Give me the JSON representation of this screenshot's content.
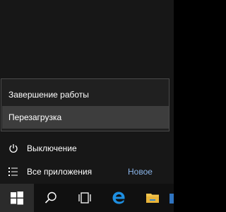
{
  "power_menu": {
    "shutdown_label": "Завершение работы",
    "restart_label": "Перезагрузка",
    "hovered_item": "restart"
  },
  "start_menu": {
    "power_label": "Выключение",
    "all_apps_label": "Все приложения",
    "new_badge": "Новое"
  },
  "taskbar": {
    "buttons": [
      "windows-logo-icon",
      "search-icon",
      "task-view-icon",
      "edge-icon",
      "file-explorer-icon",
      "store-icon"
    ]
  },
  "colors": {
    "menu_background": "#171717",
    "flyout_background": "#202020",
    "flyout_hover": "#3d3d3d",
    "new_badge": "#8ab4e8",
    "edge_blue": "#1e8fe1",
    "explorer_yellow": "#f2c44c"
  }
}
